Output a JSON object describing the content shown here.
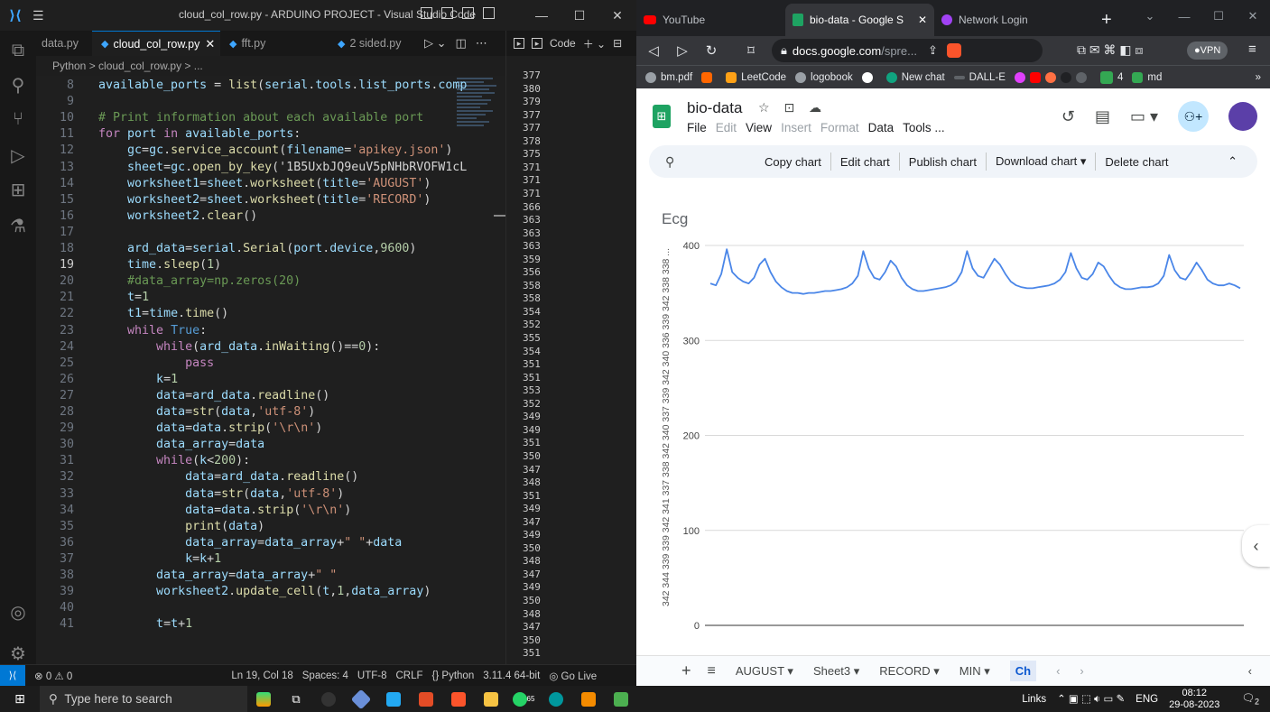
{
  "vscode": {
    "window_title": "cloud_col_row.py - ARDUINO PROJECT - Visual Studio Code",
    "tabs": [
      {
        "label": "data.py",
        "active": false
      },
      {
        "label": "cloud_col_row.py",
        "active": true
      },
      {
        "label": "fft.py",
        "active": false
      },
      {
        "label": "2 sided.py",
        "active": false
      }
    ],
    "breadcrumb": "Python > cloud_col_row.py > ...",
    "panel_label": "Code",
    "code_lines": [
      {
        "n": "8",
        "text": "available_ports = list(serial.tools.list_ports.comp"
      },
      {
        "n": "9",
        "text": ""
      },
      {
        "n": "10",
        "text": "# Print information about each available port"
      },
      {
        "n": "11",
        "text": "for port in available_ports:"
      },
      {
        "n": "12",
        "text": "    gc=gc.service_account(filename='apikey.json')"
      },
      {
        "n": "13",
        "text": "    sheet=gc.open_by_key('1B5UxbJQ9euV5pNHbRVOFW1cL"
      },
      {
        "n": "14",
        "text": "    worksheet1=sheet.worksheet(title='AUGUST')"
      },
      {
        "n": "15",
        "text": "    worksheet2=sheet.worksheet(title='RECORD')"
      },
      {
        "n": "16",
        "text": "    worksheet2.clear()"
      },
      {
        "n": "17",
        "text": ""
      },
      {
        "n": "18",
        "text": "    ard_data=serial.Serial(port.device,9600)"
      },
      {
        "n": "19",
        "text": "    time.sleep(1)"
      },
      {
        "n": "20",
        "text": "    #data_array=np.zeros(20)"
      },
      {
        "n": "21",
        "text": "    t=1"
      },
      {
        "n": "22",
        "text": "    t1=time.time()"
      },
      {
        "n": "23",
        "text": "    while True:"
      },
      {
        "n": "24",
        "text": "        while(ard_data.inWaiting()==0):"
      },
      {
        "n": "25",
        "text": "            pass"
      },
      {
        "n": "26",
        "text": "        k=1"
      },
      {
        "n": "27",
        "text": "        data=ard_data.readline()"
      },
      {
        "n": "28",
        "text": "        data=str(data,'utf-8')"
      },
      {
        "n": "29",
        "text": "        data=data.strip('\\r\\n')"
      },
      {
        "n": "30",
        "text": "        data_array=data"
      },
      {
        "n": "31",
        "text": "        while(k<200):"
      },
      {
        "n": "32",
        "text": "            data=ard_data.readline()"
      },
      {
        "n": "33",
        "text": "            data=str(data,'utf-8')"
      },
      {
        "n": "34",
        "text": "            data=data.strip('\\r\\n')"
      },
      {
        "n": "35",
        "text": "            print(data)"
      },
      {
        "n": "36",
        "text": "            data_array=data_array+\" \"+data"
      },
      {
        "n": "37",
        "text": "            k=k+1"
      },
      {
        "n": "38",
        "text": "        data_array=data_array+\" \""
      },
      {
        "n": "39",
        "text": "        worksheet2.update_cell(t,1,data_array)"
      },
      {
        "n": "40",
        "text": ""
      },
      {
        "n": "41",
        "text": "        t=t+1"
      }
    ],
    "output_values": [
      "377",
      "380",
      "379",
      "377",
      "377",
      "378",
      "375",
      "371",
      "371",
      "371",
      "366",
      "363",
      "363",
      "363",
      "359",
      "356",
      "358",
      "358",
      "354",
      "352",
      "355",
      "354",
      "351",
      "351",
      "353",
      "352",
      "349",
      "349",
      "351",
      "350",
      "347",
      "348",
      "351",
      "349",
      "347",
      "349",
      "350",
      "348",
      "347",
      "349",
      "350",
      "348",
      "347",
      "350",
      "351"
    ],
    "status": {
      "problems": "⊗ 0 ⚠ 0",
      "position": "Ln 19, Col 18",
      "spaces": "Spaces: 4",
      "encoding": "UTF-8",
      "eol": "CRLF",
      "language": "{} Python",
      "interpreter": "3.11.4 64-bit",
      "golive": "Go Live"
    }
  },
  "browser": {
    "tabs": [
      {
        "label": "YouTube",
        "active": false
      },
      {
        "label": "bio-data - Google S",
        "active": true
      },
      {
        "label": "Network Login",
        "active": false
      }
    ],
    "url_domain": "docs.google.com",
    "url_path": "/spre...",
    "vpn_label": "VPN",
    "bookmarks": [
      "bm.pdf",
      "LeetCode",
      "logobook",
      "New chat",
      "DALL-E",
      "4",
      "md"
    ],
    "sheets": {
      "doc_title": "bio-data",
      "menu": [
        {
          "label": "File",
          "dim": false
        },
        {
          "label": "Edit",
          "dim": true
        },
        {
          "label": "View",
          "dim": false
        },
        {
          "label": "Insert",
          "dim": true
        },
        {
          "label": "Format",
          "dim": true
        },
        {
          "label": "Data",
          "dim": false
        },
        {
          "label": "Tools ...",
          "dim": false
        }
      ],
      "chart_toolbar": [
        "Copy chart",
        "Edit chart",
        "Publish chart",
        "Download chart ▾",
        "Delete chart"
      ],
      "sheet_tabs": [
        {
          "label": "AUGUST ▾",
          "active": false
        },
        {
          "label": "Sheet3 ▾",
          "active": false
        },
        {
          "label": "RECORD ▾",
          "active": false
        },
        {
          "label": "MIN ▾",
          "active": false
        },
        {
          "label": "Ch",
          "active": true
        }
      ]
    }
  },
  "chart_data": {
    "type": "line",
    "title": "Ecg",
    "xlabel": "342 344 339 339 342 341 337 338 342 340 337 339 342 340 336 339 342 338 338 ...",
    "ylabel": "",
    "ylim": [
      0,
      400
    ],
    "yticks": [
      0,
      100,
      200,
      300,
      400
    ],
    "grid": true,
    "legend": "none",
    "series": [
      {
        "color": "#4a86e8",
        "values": [
          360,
          358,
          370,
          396,
          372,
          366,
          362,
          360,
          366,
          380,
          386,
          372,
          362,
          356,
          352,
          350,
          350,
          349,
          350,
          350,
          351,
          352,
          352,
          353,
          354,
          356,
          360,
          368,
          394,
          376,
          366,
          364,
          372,
          384,
          378,
          366,
          358,
          354,
          352,
          352,
          353,
          354,
          355,
          356,
          358,
          362,
          372,
          394,
          376,
          368,
          366,
          376,
          386,
          380,
          370,
          362,
          358,
          356,
          355,
          355,
          356,
          357,
          358,
          360,
          364,
          372,
          392,
          376,
          366,
          364,
          370,
          382,
          378,
          368,
          360,
          356,
          354,
          354,
          355,
          356,
          356,
          357,
          360,
          368,
          390,
          374,
          366,
          364,
          372,
          382,
          374,
          364,
          360,
          358,
          358,
          360,
          358,
          355
        ]
      }
    ]
  },
  "taskbar": {
    "search_placeholder": "Type here to search",
    "tray_links": "Links",
    "language": "ENG",
    "time": "08:12",
    "date": "29-08-2023",
    "notif_count": "2",
    "badge_whatsapp": "65"
  }
}
